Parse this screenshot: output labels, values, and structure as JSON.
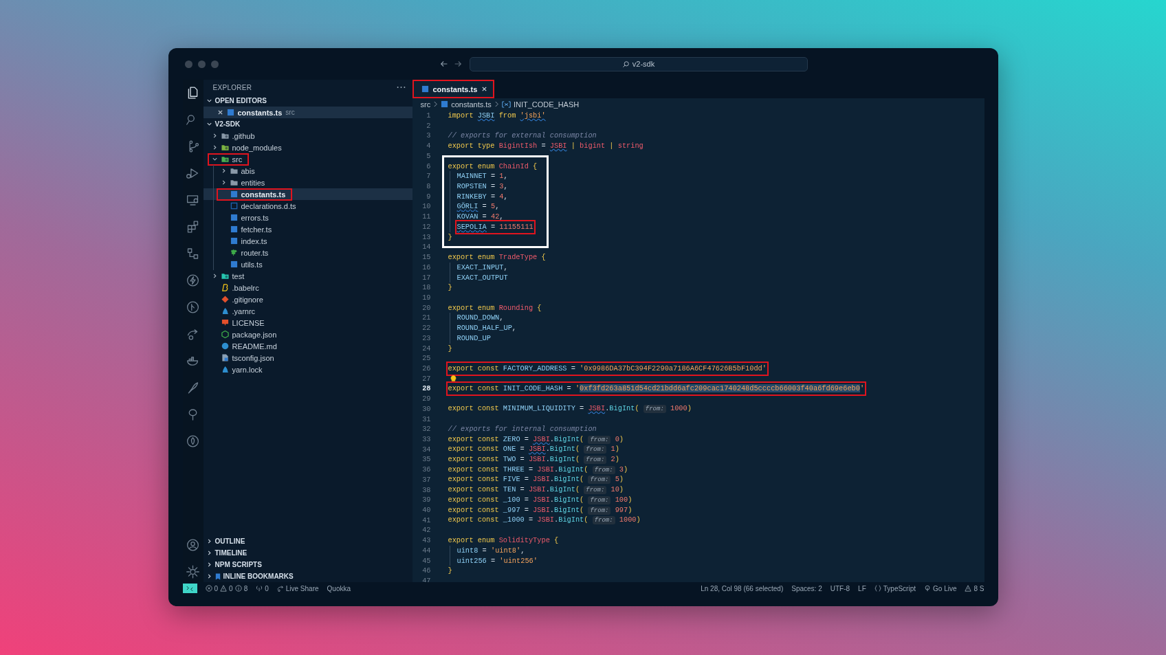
{
  "title_bar": {
    "search": "v2-sdk"
  },
  "activity_bar": [
    {
      "selected": true
    },
    {
      "selected": false
    },
    {
      "selected": false
    },
    {
      "selected": false
    },
    {
      "selected": false
    },
    {
      "selected": false
    },
    {
      "selected": false
    },
    {
      "selected": false
    },
    {
      "selected": false
    },
    {
      "selected": false
    },
    {
      "selected": false
    },
    {
      "selected": false
    },
    {
      "selected": false
    },
    {
      "selected": false
    }
  ],
  "explorer": {
    "title": "EXPLORER",
    "open_editors": {
      "title": "OPEN EDITORS",
      "expanded": true,
      "items": [
        {
          "name": "constants.ts",
          "description": "src",
          "selected": true
        }
      ]
    },
    "project": {
      "title": "V2-SDK",
      "expanded": true
    },
    "tree": [
      {
        "name": ".github",
        "kind": "github",
        "expanded": false,
        "selected": false,
        "highlighted": false
      },
      {
        "name": "node_modules",
        "kind": "modules",
        "expanded": false,
        "selected": false,
        "highlighted": false
      },
      {
        "name": "src",
        "kind": "source",
        "expanded": true,
        "selected": false,
        "highlighted": true,
        "children": [
          {
            "name": "abis",
            "kind": "folder",
            "expanded": false,
            "selected": false,
            "highlighted": false
          },
          {
            "name": "entities",
            "kind": "folder",
            "expanded": false,
            "selected": false,
            "highlighted": false
          },
          {
            "name": "constants.ts",
            "kind": "typescript",
            "selected": true,
            "highlighted": true
          },
          {
            "name": "declarations.d.ts",
            "kind": "declaration",
            "selected": false,
            "highlighted": false
          },
          {
            "name": "errors.ts",
            "kind": "typescript",
            "selected": false,
            "highlighted": false
          },
          {
            "name": "fetcher.ts",
            "kind": "typescript",
            "selected": false,
            "highlighted": false
          },
          {
            "name": "index.ts",
            "kind": "typescript",
            "selected": false,
            "highlighted": false
          },
          {
            "name": "router.ts",
            "kind": "router",
            "selected": false,
            "highlighted": false
          },
          {
            "name": "utils.ts",
            "kind": "typescript",
            "selected": false,
            "highlighted": false
          }
        ]
      },
      {
        "name": "test",
        "kind": "tests",
        "expanded": false,
        "selected": false,
        "highlighted": false
      },
      {
        "name": ".babelrc",
        "kind": "babel",
        "selected": false,
        "highlighted": false
      },
      {
        "name": ".gitignore",
        "kind": "git",
        "selected": false,
        "highlighted": false
      },
      {
        "name": ".yarnrc",
        "kind": "yarn",
        "selected": false,
        "highlighted": false
      },
      {
        "name": "LICENSE",
        "kind": "license",
        "selected": false,
        "highlighted": false
      },
      {
        "name": "package.json",
        "kind": "npm",
        "selected": false,
        "highlighted": false
      },
      {
        "name": "README.md",
        "kind": "readme",
        "selected": false,
        "highlighted": false
      },
      {
        "name": "tsconfig.json",
        "kind": "tsconfig",
        "selected": false,
        "highlighted": false
      },
      {
        "name": "yarn.lock",
        "kind": "yarn",
        "selected": false,
        "highlighted": false
      }
    ],
    "panels": [
      {
        "title": "OUTLINE",
        "kind": "plain",
        "expanded": false
      },
      {
        "title": "TIMELINE",
        "kind": "plain",
        "expanded": false
      },
      {
        "title": "NPM SCRIPTS",
        "kind": "plain",
        "expanded": false
      },
      {
        "title": "INLINE BOOKMARKS",
        "kind": "bookmarks",
        "expanded": false
      }
    ]
  },
  "tabs": [
    {
      "label": "constants.ts",
      "selected": true,
      "highlighted": true
    }
  ],
  "breadcrumb": [
    {
      "label": "src",
      "kind": "folder"
    },
    {
      "label": "constants.ts",
      "kind": "file"
    },
    {
      "label": "INIT_CODE_HASH",
      "kind": "symbol"
    }
  ],
  "editor": {
    "blocks": [
      {
        "lines": [
          {
            "n": "1",
            "tokens": [
              {
                "text": "import ",
                "kind": "kw"
              },
              {
                "text": "JSBI",
                "kind": "namesq"
              },
              {
                "text": " from ",
                "kind": "kw"
              },
              {
                "text": "'jsbi'",
                "kind": "strsq"
              }
            ]
          },
          {
            "n": "2"
          },
          {
            "n": "3",
            "tokens": [
              {
                "text": "// exports for external consumption",
                "kind": "cmt"
              }
            ]
          },
          {
            "n": "4",
            "tokens": [
              {
                "text": "export type ",
                "kind": "kw"
              },
              {
                "text": "BigintIsh",
                "kind": "type"
              },
              {
                "text": " = ",
                "kind": "p"
              },
              {
                "text": "JSBI",
                "kind": "typesq"
              },
              {
                "text": " | ",
                "kind": "br"
              },
              {
                "text": "bigint",
                "kind": "type"
              },
              {
                "text": " | ",
                "kind": "br"
              },
              {
                "text": "string",
                "kind": "type"
              }
            ]
          },
          {
            "n": "5"
          }
        ]
      },
      {
        "framed": true,
        "lines": [
          {
            "n": "6",
            "tokens": [
              {
                "text": "export enum ",
                "kind": "kw"
              },
              {
                "text": "ChainId",
                "kind": "type"
              },
              {
                "text": " {",
                "kind": "br"
              }
            ]
          },
          {
            "n": "7",
            "indented": true,
            "tokens": [
              {
                "text": "MAINNET",
                "kind": "name"
              },
              {
                "text": " = ",
                "kind": "p"
              },
              {
                "text": "1",
                "kind": "num"
              },
              {
                "text": ",",
                "kind": "p"
              }
            ]
          },
          {
            "n": "8",
            "indented": true,
            "tokens": [
              {
                "text": "ROPSTEN",
                "kind": "name"
              },
              {
                "text": " = ",
                "kind": "p"
              },
              {
                "text": "3",
                "kind": "num"
              },
              {
                "text": ",",
                "kind": "p"
              }
            ]
          },
          {
            "n": "9",
            "indented": true,
            "tokens": [
              {
                "text": "RINKEBY",
                "kind": "name"
              },
              {
                "text": " = ",
                "kind": "p"
              },
              {
                "text": "4",
                "kind": "num"
              },
              {
                "text": ",",
                "kind": "p"
              }
            ]
          },
          {
            "n": "10",
            "indented": true,
            "tokens": [
              {
                "text": "GÖRLI",
                "kind": "namesq"
              },
              {
                "text": " = ",
                "kind": "p"
              },
              {
                "text": "5",
                "kind": "num"
              },
              {
                "text": ",",
                "kind": "p"
              }
            ]
          },
          {
            "n": "11",
            "indented": true,
            "tokens": [
              {
                "text": "KOVAN",
                "kind": "name"
              },
              {
                "text": " = ",
                "kind": "p"
              },
              {
                "text": "42",
                "kind": "num"
              },
              {
                "text": ",",
                "kind": "p"
              }
            ]
          },
          {
            "n": "12",
            "indented": true,
            "highlighted": true,
            "tokens": [
              {
                "text": "SEPOLIA",
                "kind": "namesq"
              },
              {
                "text": " = ",
                "kind": "p"
              },
              {
                "text": "11155111",
                "kind": "num"
              }
            ]
          },
          {
            "n": "13",
            "tokens": [
              {
                "text": "}",
                "kind": "br"
              }
            ]
          }
        ]
      },
      {
        "lines": [
          {
            "n": "14"
          },
          {
            "n": "15",
            "tokens": [
              {
                "text": "export enum ",
                "kind": "kw"
              },
              {
                "text": "TradeType",
                "kind": "type"
              },
              {
                "text": " {",
                "kind": "br"
              }
            ]
          },
          {
            "n": "16",
            "indented": true,
            "tokens": [
              {
                "text": "EXACT_INPUT",
                "kind": "name"
              },
              {
                "text": ",",
                "kind": "p"
              }
            ]
          },
          {
            "n": "17",
            "indented": true,
            "tokens": [
              {
                "text": "EXACT_OUTPUT",
                "kind": "name"
              }
            ]
          },
          {
            "n": "18",
            "tokens": [
              {
                "text": "}",
                "kind": "br"
              }
            ]
          },
          {
            "n": "19"
          },
          {
            "n": "20",
            "tokens": [
              {
                "text": "export enum ",
                "kind": "kw"
              },
              {
                "text": "Rounding",
                "kind": "type"
              },
              {
                "text": " {",
                "kind": "br"
              }
            ]
          },
          {
            "n": "21",
            "indented": true,
            "tokens": [
              {
                "text": "ROUND_DOWN",
                "kind": "name"
              },
              {
                "text": ",",
                "kind": "p"
              }
            ]
          },
          {
            "n": "22",
            "indented": true,
            "tokens": [
              {
                "text": "ROUND_HALF_UP",
                "kind": "name"
              },
              {
                "text": ",",
                "kind": "p"
              }
            ]
          },
          {
            "n": "23",
            "indented": true,
            "tokens": [
              {
                "text": "ROUND_UP",
                "kind": "name"
              }
            ]
          },
          {
            "n": "24",
            "tokens": [
              {
                "text": "}",
                "kind": "br"
              }
            ]
          },
          {
            "n": "25"
          },
          {
            "n": "26",
            "highlighted": true,
            "tokens": [
              {
                "text": "export const ",
                "kind": "kw"
              },
              {
                "text": "FACTORY_ADDRESS",
                "kind": "name"
              },
              {
                "text": " = ",
                "kind": "p"
              },
              {
                "text": "'0x9986DA37bC394F2290a7186A6CF47626B5bF10dd'",
                "kind": "str"
              }
            ]
          },
          {
            "n": "27",
            "lightbulb": true
          },
          {
            "n": "28",
            "current": true,
            "highlighted": true,
            "tokens": [
              {
                "text": "export const ",
                "kind": "kw"
              },
              {
                "text": "INIT_CODE_HASH",
                "kind": "name"
              },
              {
                "text": " = ",
                "kind": "p"
              },
              {
                "text": "'",
                "kind": "str"
              },
              {
                "text": "0xf3fd263a851d54cd21bdd6afc209cac1740248d5ccccb66003f40a6fd69e6eb0",
                "kind": "strsel"
              },
              {
                "text": "'",
                "kind": "str"
              }
            ]
          },
          {
            "n": "29"
          },
          {
            "n": "30",
            "tokens": [
              {
                "text": "export const ",
                "kind": "kw"
              },
              {
                "text": "MINIMUM_LIQUIDITY",
                "kind": "name"
              },
              {
                "text": " = ",
                "kind": "p"
              },
              {
                "text": "JSBI",
                "kind": "typesq"
              },
              {
                "text": ".",
                "kind": "p"
              },
              {
                "text": "BigInt",
                "kind": "fn"
              },
              {
                "text": "( ",
                "kind": "br"
              },
              {
                "text": "from:",
                "kind": "hint"
              },
              {
                "text": " 1000",
                "kind": "num"
              },
              {
                "text": ")",
                "kind": "br"
              }
            ]
          },
          {
            "n": "31"
          },
          {
            "n": "32",
            "tokens": [
              {
                "text": "// exports for internal consumption",
                "kind": "cmt"
              }
            ]
          },
          {
            "n": "33",
            "tokens": [
              {
                "text": "export const ",
                "kind": "kw"
              },
              {
                "text": "ZERO",
                "kind": "name"
              },
              {
                "text": " = ",
                "kind": "p"
              },
              {
                "text": "JSBI",
                "kind": "typesq"
              },
              {
                "text": ".",
                "kind": "p"
              },
              {
                "text": "BigInt",
                "kind": "fn"
              },
              {
                "text": "( ",
                "kind": "br"
              },
              {
                "text": "from:",
                "kind": "hint"
              },
              {
                "text": " 0",
                "kind": "num"
              },
              {
                "text": ")",
                "kind": "br"
              }
            ]
          },
          {
            "n": "34",
            "tokens": [
              {
                "text": "export const ",
                "kind": "kw"
              },
              {
                "text": "ONE",
                "kind": "name"
              },
              {
                "text": " = ",
                "kind": "p"
              },
              {
                "text": "JSBI",
                "kind": "typesq"
              },
              {
                "text": ".",
                "kind": "p"
              },
              {
                "text": "BigInt",
                "kind": "fn"
              },
              {
                "text": "( ",
                "kind": "br"
              },
              {
                "text": "from:",
                "kind": "hint"
              },
              {
                "text": " 1",
                "kind": "num"
              },
              {
                "text": ")",
                "kind": "br"
              }
            ]
          },
          {
            "n": "35",
            "tokens": [
              {
                "text": "export const ",
                "kind": "kw"
              },
              {
                "text": "TWO",
                "kind": "name"
              },
              {
                "text": " = ",
                "kind": "p"
              },
              {
                "text": "JSBI",
                "kind": "type"
              },
              {
                "text": ".",
                "kind": "p"
              },
              {
                "text": "BigInt",
                "kind": "fn"
              },
              {
                "text": "( ",
                "kind": "br"
              },
              {
                "text": "from:",
                "kind": "hint"
              },
              {
                "text": " 2",
                "kind": "num"
              },
              {
                "text": ")",
                "kind": "br"
              }
            ]
          },
          {
            "n": "36",
            "tokens": [
              {
                "text": "export const ",
                "kind": "kw"
              },
              {
                "text": "THREE",
                "kind": "name"
              },
              {
                "text": " = ",
                "kind": "p"
              },
              {
                "text": "JSBI",
                "kind": "type"
              },
              {
                "text": ".",
                "kind": "p"
              },
              {
                "text": "BigInt",
                "kind": "fn"
              },
              {
                "text": "( ",
                "kind": "br"
              },
              {
                "text": "from:",
                "kind": "hint"
              },
              {
                "text": " 3",
                "kind": "num"
              },
              {
                "text": ")",
                "kind": "br"
              }
            ]
          },
          {
            "n": "37",
            "tokens": [
              {
                "text": "export const ",
                "kind": "kw"
              },
              {
                "text": "FIVE",
                "kind": "name"
              },
              {
                "text": " = ",
                "kind": "p"
              },
              {
                "text": "JSBI",
                "kind": "type"
              },
              {
                "text": ".",
                "kind": "p"
              },
              {
                "text": "BigInt",
                "kind": "fn"
              },
              {
                "text": "( ",
                "kind": "br"
              },
              {
                "text": "from:",
                "kind": "hint"
              },
              {
                "text": " 5",
                "kind": "num"
              },
              {
                "text": ")",
                "kind": "br"
              }
            ]
          },
          {
            "n": "38",
            "tokens": [
              {
                "text": "export const ",
                "kind": "kw"
              },
              {
                "text": "TEN",
                "kind": "name"
              },
              {
                "text": " = ",
                "kind": "p"
              },
              {
                "text": "JSBI",
                "kind": "type"
              },
              {
                "text": ".",
                "kind": "p"
              },
              {
                "text": "BigInt",
                "kind": "fn"
              },
              {
                "text": "( ",
                "kind": "br"
              },
              {
                "text": "from:",
                "kind": "hint"
              },
              {
                "text": " 10",
                "kind": "num"
              },
              {
                "text": ")",
                "kind": "br"
              }
            ]
          },
          {
            "n": "39",
            "tokens": [
              {
                "text": "export const ",
                "kind": "kw"
              },
              {
                "text": "_100",
                "kind": "name"
              },
              {
                "text": " = ",
                "kind": "p"
              },
              {
                "text": "JSBI",
                "kind": "type"
              },
              {
                "text": ".",
                "kind": "p"
              },
              {
                "text": "BigInt",
                "kind": "fn"
              },
              {
                "text": "( ",
                "kind": "br"
              },
              {
                "text": "from:",
                "kind": "hint"
              },
              {
                "text": " 100",
                "kind": "num"
              },
              {
                "text": ")",
                "kind": "br"
              }
            ]
          },
          {
            "n": "40",
            "tokens": [
              {
                "text": "export const ",
                "kind": "kw"
              },
              {
                "text": "_997",
                "kind": "name"
              },
              {
                "text": " = ",
                "kind": "p"
              },
              {
                "text": "JSBI",
                "kind": "type"
              },
              {
                "text": ".",
                "kind": "p"
              },
              {
                "text": "BigInt",
                "kind": "fn"
              },
              {
                "text": "( ",
                "kind": "br"
              },
              {
                "text": "from:",
                "kind": "hint"
              },
              {
                "text": " 997",
                "kind": "num"
              },
              {
                "text": ")",
                "kind": "br"
              }
            ]
          },
          {
            "n": "41",
            "tokens": [
              {
                "text": "export const ",
                "kind": "kw"
              },
              {
                "text": "_1000",
                "kind": "name"
              },
              {
                "text": " = ",
                "kind": "p"
              },
              {
                "text": "JSBI",
                "kind": "type"
              },
              {
                "text": ".",
                "kind": "p"
              },
              {
                "text": "BigInt",
                "kind": "fn"
              },
              {
                "text": "( ",
                "kind": "br"
              },
              {
                "text": "from:",
                "kind": "hint"
              },
              {
                "text": " 1000",
                "kind": "num"
              },
              {
                "text": ")",
                "kind": "br"
              }
            ]
          },
          {
            "n": "42"
          },
          {
            "n": "43",
            "tokens": [
              {
                "text": "export enum ",
                "kind": "kw"
              },
              {
                "text": "SolidityType",
                "kind": "type"
              },
              {
                "text": " {",
                "kind": "br"
              }
            ]
          },
          {
            "n": "44",
            "indented": true,
            "tokens": [
              {
                "text": "uint8",
                "kind": "name"
              },
              {
                "text": " = ",
                "kind": "p"
              },
              {
                "text": "'uint8'",
                "kind": "str"
              },
              {
                "text": ",",
                "kind": "p"
              }
            ]
          },
          {
            "n": "45",
            "indented": true,
            "tokens": [
              {
                "text": "uint256",
                "kind": "name"
              },
              {
                "text": " = ",
                "kind": "p"
              },
              {
                "text": "'uint256'",
                "kind": "str"
              }
            ]
          },
          {
            "n": "46",
            "tokens": [
              {
                "text": "}",
                "kind": "br"
              }
            ]
          },
          {
            "n": "47"
          }
        ]
      }
    ]
  },
  "status_bar": {
    "problems": {
      "errors": "0",
      "warnings": "0",
      "infos": "8"
    },
    "ports": "0",
    "live_share": "Live Share",
    "quokka": "Quokka",
    "position": "Ln 28, Col 98 (66 selected)",
    "spaces": "Spaces: 2",
    "encoding": "UTF-8",
    "eol": "LF",
    "language": "TypeScript",
    "go_live": "Go Live",
    "notifications": "8 S"
  }
}
